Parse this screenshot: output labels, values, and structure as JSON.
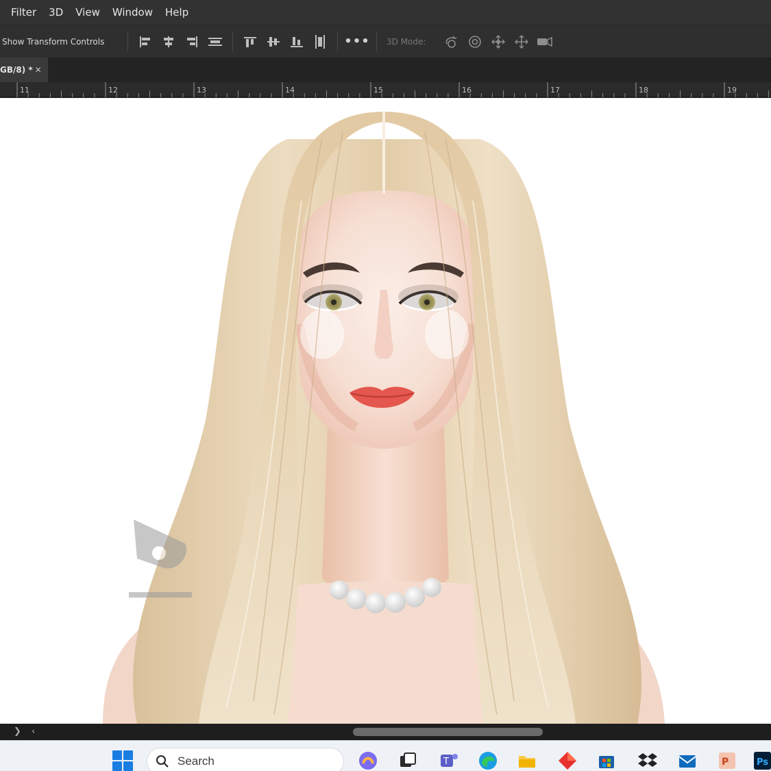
{
  "menubar": {
    "items": [
      "Filter",
      "3D",
      "View",
      "Window",
      "Help"
    ]
  },
  "options": {
    "show_transform_label": "Show Transform Controls",
    "more_label": "•••",
    "mode_label": "3D Mode:",
    "align_icons": [
      "align-left-edges-icon",
      "align-horizontal-centers-icon",
      "align-right-edges-icon",
      "distribute-horizontal-icon",
      "align-top-edges-icon",
      "align-vertical-centers-icon",
      "align-bottom-edges-icon",
      "distribute-vertical-icon"
    ],
    "mode_icons": [
      "orbit-3d-icon",
      "roll-3d-icon",
      "pan-3d-icon",
      "slide-3d-icon",
      "scale-3d-camera-icon"
    ]
  },
  "document_tab": {
    "label": "GB/8) *",
    "close_label": "✕"
  },
  "ruler": {
    "labels": [
      "11",
      "12",
      "13",
      "14",
      "15",
      "16",
      "17",
      "18",
      "19"
    ]
  },
  "canvas": {
    "description_colors": {
      "hair": "#e6d2b2",
      "skin": "#f4ddd0",
      "lips": "#e4574e",
      "eyes": "#a9a35a"
    }
  },
  "scrollbar": {
    "left_arrow": "❯",
    "right_arrow": "‹"
  },
  "taskbar": {
    "search_placeholder": "Search",
    "apps": [
      "copilot-app-icon",
      "task-view-icon",
      "teams-app-icon",
      "edge-browser-icon",
      "file-explorer-icon",
      "red-diamond-app-icon",
      "store-app-icon",
      "dropbox-app-icon",
      "mail-app-icon",
      "powerpoint-app-icon",
      "photoshop-app-icon"
    ]
  }
}
